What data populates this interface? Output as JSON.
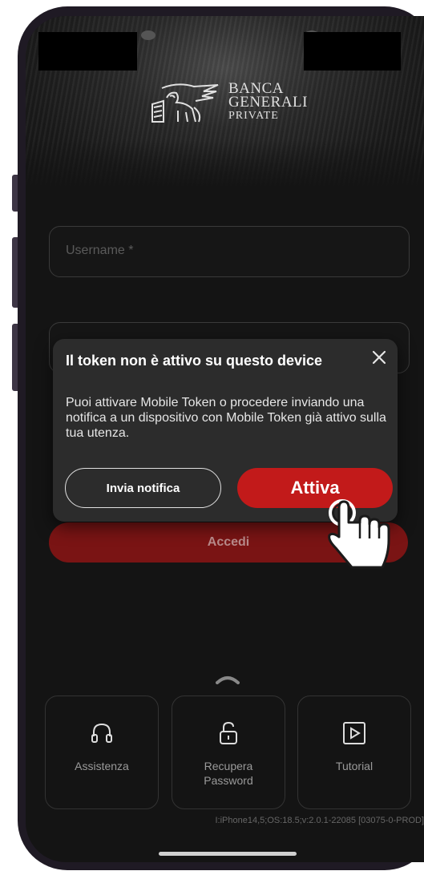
{
  "brand": {
    "line1": "BANCA",
    "line2": "GENERALI",
    "line3": "PRIVATE"
  },
  "login": {
    "username_placeholder": "Username *",
    "accedi_label": "Accedi"
  },
  "dialog": {
    "title": "Il token non è attivo su questo device",
    "body": "Puoi attivare Mobile Token o procedere inviando una notifica a un dispositivo con Mobile Token già attivo sulla tua utenza.",
    "secondary_label": "Invia notifica",
    "primary_label": "Attiva",
    "close_icon": "close-icon"
  },
  "quick_actions": [
    {
      "label": "Assistenza",
      "icon": "headset-icon"
    },
    {
      "label": "Recupera Password",
      "icon": "unlock-icon"
    },
    {
      "label": "Tutorial",
      "icon": "play-icon"
    }
  ],
  "footer": {
    "device_info": "I:iPhone14,5;OS:18.5;v:2.0.1-22085 [03075-0-PROD]"
  },
  "colors": {
    "accent": "#c21a1a",
    "accedi_bg": "#7a1414",
    "background": "#141414",
    "dialog_bg": "#2c2c2c"
  }
}
